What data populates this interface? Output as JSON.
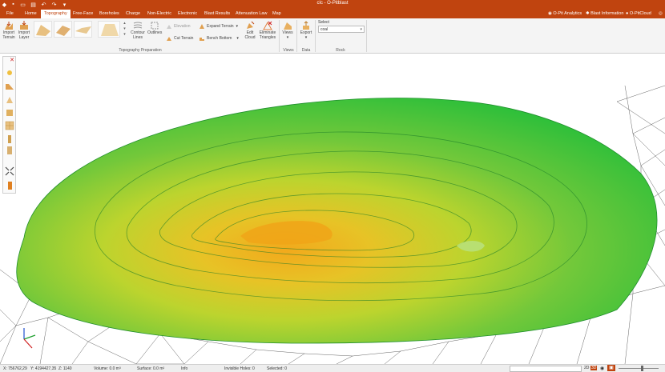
{
  "app": {
    "title": "clc - O-Pitblast"
  },
  "menu": {
    "tabs": [
      "File",
      "Home",
      "Topography",
      "Free-Face",
      "Boreholes",
      "Charge",
      "Non-Electric",
      "Electronic",
      "Blast Results",
      "Attenuation Law",
      "Map"
    ],
    "active": "Topography",
    "right_links": [
      "O-Pit Analytics",
      "Blast Information",
      "O-PitCloud"
    ]
  },
  "ribbon": {
    "import_terrain": "Import Terrain",
    "import_layer": "Import Layer",
    "contour_lines": "Contour Lines",
    "outlines": "Outlines",
    "elevation": "Elevation",
    "cut_terrain": "Cut Terrain",
    "expand_terrain": "Expand Terrain",
    "bench_bottom": "Bench Bottom",
    "edit_cloud": "Edit Cloud",
    "eliminate_triangles": "Eliminate Triangles",
    "views": "Views",
    "export": "Export",
    "select_label": "Select",
    "select_value": "coal",
    "groups": {
      "topography_preparation": "Topography Preparation",
      "views": "Views",
      "data": "Data",
      "rock": "Rock"
    }
  },
  "status": {
    "x": "X: 756762,29",
    "y": "Y: 4194427,35",
    "z": "Z: 1140",
    "volume": "Volume: 0.0 m³",
    "surface": "Surface: 0.0 m²",
    "info": "Info",
    "invisible_holes": "Invisible Holes: 0",
    "selected": "Selected: 0",
    "view_2d": "2D",
    "view_3d": "3D"
  },
  "colors": {
    "accent": "#c0440f",
    "terrain_high": "#f0a81c",
    "terrain_mid": "#b8d22e",
    "terrain_low": "#2cbf3a"
  }
}
